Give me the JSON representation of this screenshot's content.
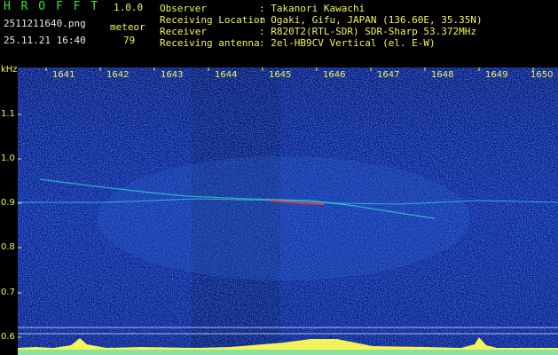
{
  "app": {
    "title": "H R O F F T",
    "version": "1.0.0",
    "filename": "2511211640.png",
    "mode": "meteor",
    "timestamp": "25.11.21 16:40",
    "count": "79"
  },
  "station": {
    "observer_label": "Observer",
    "observer_value": ": Takanori Kawachi",
    "location_label": "Receiving Location",
    "location_value": ": Ogaki, Gifu, JAPAN (136.60E, 35.35N)",
    "receiver_label": "Receiver",
    "receiver_value": ": R820T2(RTL-SDR) SDR-Sharp 53.372MHz",
    "antenna_label": "Receiving antenna",
    "antenna_value": ": 2el-HB9CV Vertical (el. E-W)"
  },
  "axis": {
    "unit": "kHz",
    "freq_ticks": [
      "1.1",
      "1.0",
      "0.9",
      "0.8",
      "0.7",
      "0.6"
    ],
    "time_ticks": [
      "1641",
      "1642",
      "1643",
      "1644",
      "1645",
      "1646",
      "1647",
      "1648",
      "1649",
      "1650"
    ]
  },
  "colors": {
    "background": "#0b1f8c",
    "label_yellow": "#f3f35a",
    "label_green": "#2ee82e",
    "trace_cyan": "#36e0d6",
    "trace_red": "#ff3a2a"
  }
}
